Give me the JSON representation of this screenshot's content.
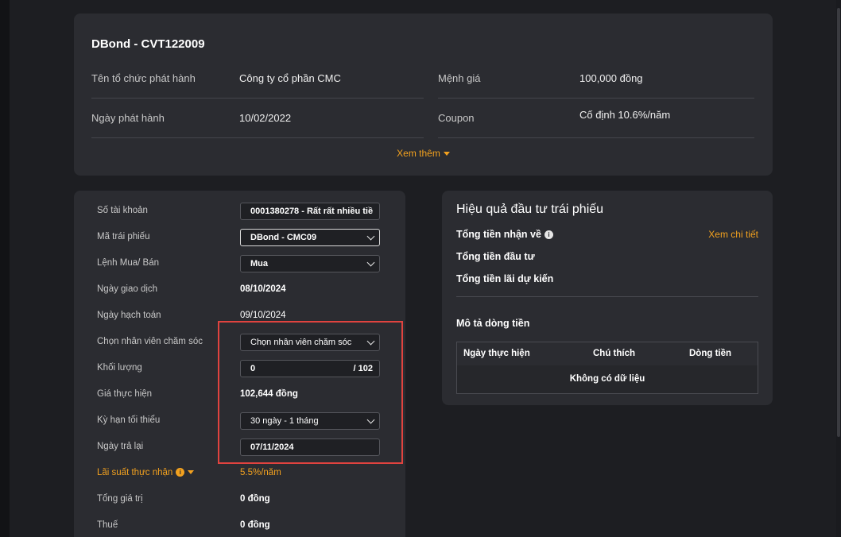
{
  "bond": {
    "title": "DBond - CVT122009",
    "issuer_label": "Tên tổ chức phát hành",
    "issuer_value": "Công ty cổ phần CMC",
    "face_value_label": "Mệnh giá",
    "face_value": "100,000 đồng",
    "issue_date_label": "Ngày phát hành",
    "issue_date": "10/02/2022",
    "coupon_label": "Coupon",
    "coupon_value": "Cố định 10.6%/năm",
    "see_more": "Xem thêm"
  },
  "order": {
    "account_label": "Số tài khoản",
    "account_value": "0001380278 - Rất rất nhiều tiề",
    "bond_code_label": "Mã trái phiếu",
    "bond_code_value": "DBond - CMC09",
    "side_label": "Lệnh Mua/ Bán",
    "side_value": "Mua",
    "trade_date_label": "Ngày giao dịch",
    "trade_date": "08/10/2024",
    "settle_date_label": "Ngày hạch toán",
    "settle_date": "09/10/2024",
    "staff_label": "Chọn nhân viên chăm sóc",
    "staff_value": "Chọn nhân viên chăm sóc",
    "qty_label": "Khối lượng",
    "qty_value": "0",
    "qty_max": "/ 102",
    "price_label": "Giá thực hiện",
    "price_value": "102,644 đồng",
    "term_label": "Kỳ hạn tối thiểu",
    "term_value": "30 ngày - 1 tháng",
    "return_date_label": "Ngày trả lại",
    "return_date": "07/11/2024",
    "rate_label": "Lãi suất thực nhận",
    "rate_value": "5.5%/năm",
    "total_label": "Tổng giá trị",
    "total_value": "0 đồng",
    "tax_label": "Thuế",
    "tax_value": "0 đồng"
  },
  "performance": {
    "title": "Hiệu quả đầu tư trái phiếu",
    "received_label": "Tổng tiền nhận về",
    "detail_link": "Xem chi tiết",
    "invested_label": "Tổng tiền đầu tư",
    "expected_interest_label": "Tổng tiền lãi dự kiến",
    "cashflow_title": "Mô tả dòng tiền",
    "columns": [
      "Ngày thực hiện",
      "Chú thích",
      "Dòng tiền"
    ],
    "empty_text": "Không có dữ liệu"
  },
  "colors": {
    "accent": "#f2a11f",
    "highlight": "#e0433f",
    "card": "#2b2c31",
    "background": "#1d1e22"
  }
}
